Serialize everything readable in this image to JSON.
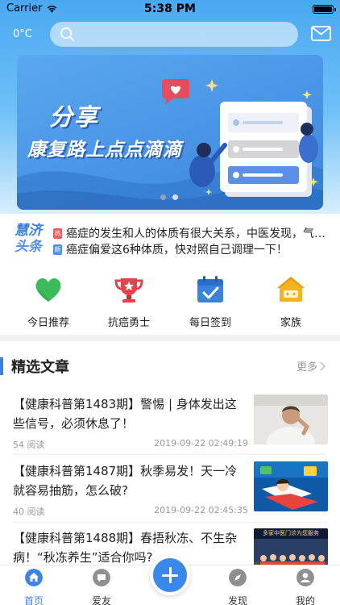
{
  "status_bar": {
    "carrier": "Carrier",
    "time": "5:38 PM"
  },
  "header": {
    "temperature": "0°C",
    "search_placeholder": ""
  },
  "banner": {
    "title_line1": "分享",
    "title_line2": "康复路上点点滴滴",
    "page_count": 2,
    "active_page": 1
  },
  "ticker": {
    "logo_line1": "慧济",
    "logo_line2": "头条",
    "items": [
      {
        "tag": "热",
        "text": "癌症的发生和人的体质有很大关系，中医发现，气…"
      },
      {
        "tag": "新",
        "text": "癌症偏爱这6种体质，快对照自己调理一下！"
      }
    ]
  },
  "quick_menu": [
    {
      "label": "今日推荐",
      "icon": "heart-icon"
    },
    {
      "label": "抗癌勇士",
      "icon": "trophy-icon"
    },
    {
      "label": "每日签到",
      "icon": "calendar-check-icon"
    },
    {
      "label": "家族",
      "icon": "house-icon"
    }
  ],
  "section": {
    "title": "精选文章",
    "more_label": "更多"
  },
  "articles": [
    {
      "title": "【健康科普第1483期】警惕 | 身体发出这些信号，必须休息了！",
      "reads": "54 阅读",
      "date": "2019-09-22 02:49:19"
    },
    {
      "title": "【健康科普第1487期】秋季易发！天一冷就容易抽筋，怎么破?",
      "reads": "40 阅读",
      "date": "2019-09-22 02:45:35"
    },
    {
      "title": "【健康科普第1488期】春捂秋冻、不生杂病！“秋冻养生”适合你吗?",
      "reads": "",
      "date": ""
    }
  ],
  "article3_thumb_caption": "多家中医门诊为您服务",
  "tabbar": [
    {
      "label": "首页",
      "icon": "home-icon",
      "active": true
    },
    {
      "label": "爱友",
      "icon": "chat-icon",
      "active": false
    },
    {
      "label": "发现",
      "icon": "compass-icon",
      "active": false
    },
    {
      "label": "我的",
      "icon": "user-icon",
      "active": false
    }
  ],
  "colors": {
    "accent": "#3d84e6",
    "header_blue": "#4aa8f2",
    "hot_tag": "#f05a5a",
    "new_tag": "#4f8fe6"
  }
}
